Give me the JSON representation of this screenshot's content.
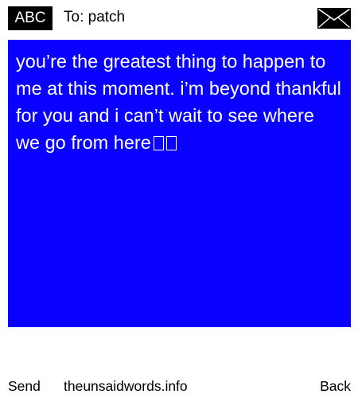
{
  "header": {
    "badge_label": "ABC",
    "to_label": "To: patch",
    "envelope_icon": "envelope-icon"
  },
  "message": {
    "text": "you’re the greatest thing to happen to me at this moment. i’m beyond thankful for you and i can’t wait to see where we go from here",
    "emoji_count": 2,
    "background_color": "#0a00ff",
    "text_color": "#ffffff"
  },
  "footer": {
    "send_label": "Send",
    "site_label": "theunsaidwords.info",
    "back_label": "Back"
  }
}
